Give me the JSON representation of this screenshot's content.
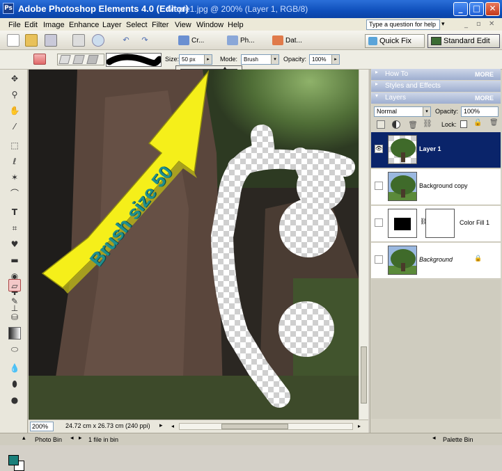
{
  "window": {
    "app_title": "Adobe Photoshop Elements 4.0 (Editor)",
    "doc_title": "Maple1.jpg @ 200% (Layer 1, RGB/8)",
    "minimize": "_",
    "maximize": "□",
    "close": "✕"
  },
  "menu": {
    "items": [
      "File",
      "Edit",
      "Image",
      "Enhance",
      "Layer",
      "Select",
      "Filter",
      "View",
      "Window",
      "Help"
    ],
    "help_placeholder": "Type a question for help"
  },
  "shortcuts": {
    "create_label": "Cr...",
    "photomerge_label": "Ph...",
    "date_label": "Dat...",
    "quick_fix": "Quick Fix",
    "standard_edit": "Standard Edit"
  },
  "options": {
    "size_label": "Size:",
    "size_value": "50 px",
    "mode_label": "Mode:",
    "mode_value": "Brush",
    "opacity_label": "Opacity:",
    "opacity_value": "100%",
    "size_slider_fraction": 0.78
  },
  "canvas": {
    "annotation": "Brush size 50",
    "frame_number": "022"
  },
  "statusbar": {
    "zoom": "200%",
    "doc_info": "24.72 cm x 26.73 cm (240 ppi)"
  },
  "palette": {
    "how_to": "How To",
    "styles": "Styles and Effects",
    "layers": "Layers",
    "more": "MORE",
    "blend_mode": "Normal",
    "opacity_label": "Opacity:",
    "opacity_value": "100%",
    "lock_label": "Lock:",
    "layers_list": [
      {
        "name": "Layer 1",
        "selected": true
      },
      {
        "name": "Background copy",
        "selected": false
      },
      {
        "name": "Color Fill 1",
        "selected": false
      },
      {
        "name": "Background",
        "selected": false
      }
    ]
  },
  "bin": {
    "photo_bin": "Photo Bin",
    "file_count": "1 file in bin",
    "palette_bin": "Palette Bin"
  },
  "colors": {
    "title_bar": "#0f4fbb",
    "selected_layer": "#0a246a",
    "annotation_arrow": "#f5ef1a",
    "annotation_text": "#1f8f8f",
    "foreground_color": "#1a7f7a"
  }
}
